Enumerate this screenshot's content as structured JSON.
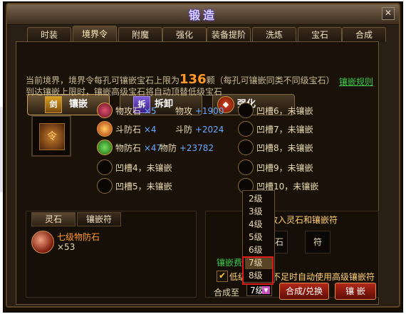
{
  "window": {
    "title": "锻造",
    "close_icon": "close-icon"
  },
  "tabs": [
    "时装",
    "境界令",
    "附魔",
    "强化",
    "装备提阶",
    "洗炼",
    "宝石",
    "合成"
  ],
  "active_tab": "境界令",
  "subtabs": {
    "inlay": {
      "label": "镶嵌",
      "icon": "sword-icon"
    },
    "remove": {
      "label": "拆卸",
      "icon": "remove-icon"
    },
    "enhance": {
      "label": "强化",
      "icon": "shield-emblem-icon"
    }
  },
  "info": {
    "line1_prefix": "当前境界，境界令每孔可镶嵌宝石上限为",
    "limit": "136",
    "line1_suffix": "颗（每孔可镶嵌同类不同级宝石）",
    "line2": "到达镶嵌上限时，镶嵌高级宝石将自动顶替低级宝石",
    "rules_link": "镶嵌规则"
  },
  "equipment_icon": "realm-token-icon",
  "slots_left": [
    {
      "name": "物攻石",
      "count": "×5",
      "stat": "物攻",
      "bonus": "+1900"
    },
    {
      "name": "斗防石",
      "count": "×4",
      "stat": "斗防",
      "bonus": "+2024"
    },
    {
      "name": "物防石",
      "count": "×47",
      "stat": "物防",
      "bonus": "+23782"
    },
    {
      "empty": "凹槽4，未镶嵌"
    },
    {
      "empty": "凹槽5，未镶嵌"
    }
  ],
  "slots_right": [
    "凹槽6，未镶嵌",
    "凹槽7，未镶嵌",
    "凹槽8，未镶嵌",
    "凹槽9，未镶嵌",
    "凹槽10，未镶嵌"
  ],
  "lower_tabs": [
    "灵石",
    "镶嵌符"
  ],
  "gem": {
    "name": "七级物防石",
    "count": "×53"
  },
  "right_panel": {
    "hint": "请放入灵石和镶嵌符",
    "spirit_label": "灵石",
    "rune_label": "符",
    "fee_label": "镶嵌费用",
    "checkbox_checked": true,
    "checkbox_label": "低级镶嵌符不足时自动使用高级镶嵌符",
    "synth_label": "合成至",
    "synth_value": "7级",
    "synth_button": "合成/兑换",
    "inlay_button": "镶 嵌"
  },
  "dropdown": {
    "options": [
      "2级",
      "3级",
      "4级",
      "5级",
      "6级",
      "7级",
      "8级"
    ],
    "highlighted": "7级"
  },
  "colors": {
    "accent_orange": "#ff9a28",
    "link_green": "#3cc84a",
    "bonus_blue": "#6aa8ff",
    "button_red": "#b02818"
  }
}
